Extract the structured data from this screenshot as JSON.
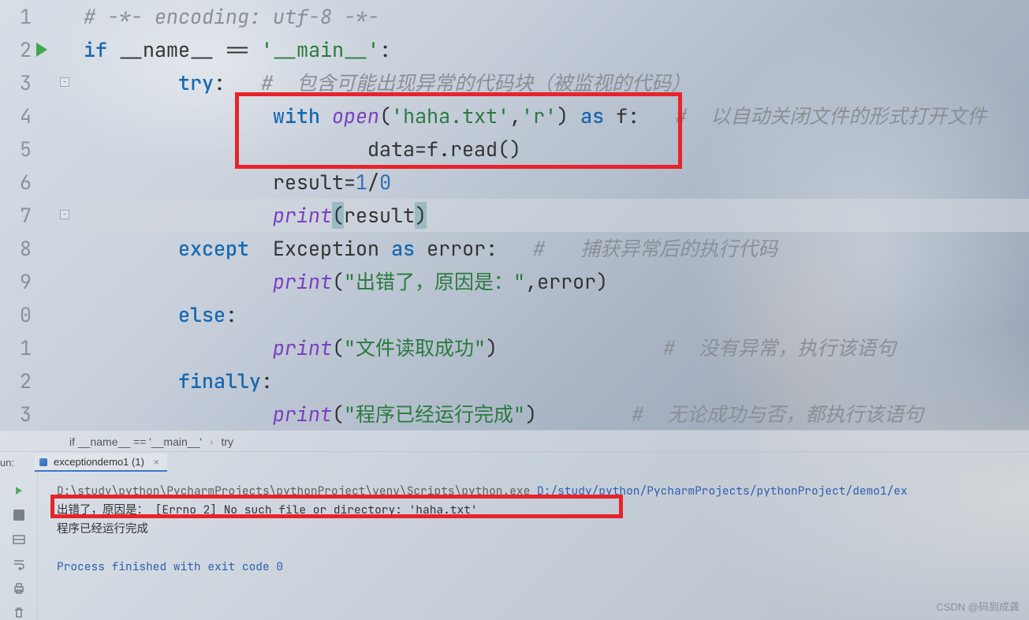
{
  "gutter": {
    "lines": [
      "1",
      "2",
      "3",
      "4",
      "5",
      "6",
      "7",
      "8",
      "9",
      "0",
      "1",
      "2",
      "3"
    ]
  },
  "code": {
    "l1_comment": "# -*- encoding: utf-8 -*-",
    "l2_if": "if",
    "l2_name": "__name__",
    "l2_eq": " == ",
    "l2_main": "'__main__'",
    "l2_colon": ":",
    "l3_try": "try",
    "l3_colon": ":",
    "l3_comment": "#  包含可能出现异常的代码块（被监视的代码）",
    "l4_with": "with",
    "l4_open": "open",
    "l4_args_a": "'haha.txt'",
    "l4_args_b": "'r'",
    "l4_as": "as",
    "l4_f": "f:",
    "l4_comment": "#  以自动关闭文件的形式打开文件",
    "l5_data": "data=f.read()",
    "l6_result_a": "result=",
    "l6_one": "1",
    "l6_slash": "/",
    "l6_zero": "0",
    "l7_print": "print",
    "l7_res": "result",
    "l8_except": "except",
    "l8_exc": "Exception",
    "l8_as": "as",
    "l8_err": "error:",
    "l8_comment": "#   捕获异常后的执行代码",
    "l9_print": "print",
    "l9_str": "\"出错了，原因是：\"",
    "l9_err": ",error)",
    "l10_else": "else",
    "l10_colon": ":",
    "l11_print": "print",
    "l11_str": "\"文件读取成功\"",
    "l11_comment": "#  没有异常，执行该语句",
    "l12_finally": "finally",
    "l12_colon": ":",
    "l13_print": "print",
    "l13_str": "\"程序已经运行完成\"",
    "l13_comment": "#  无论成功与否，都执行该语句"
  },
  "breadcrumb": {
    "a": "if __name__ == '__main__'",
    "b": "try"
  },
  "run": {
    "label": "un:",
    "tab": "exceptiondemo1 (1)",
    "console_path": "D:\\study\\python\\PycharmProjects\\pythonProject\\venv\\Scripts\\python.exe ",
    "console_arg": "D:/study/python/PycharmProjects/pythonProject/demo1/ex",
    "console_err": "出错了，原因是： [Errno 2] No such file or directory: 'haha.txt'",
    "console_done": "程序已经运行完成",
    "console_exit": "Process finished with exit code 0"
  },
  "watermark": "CSDN @码到成龚"
}
